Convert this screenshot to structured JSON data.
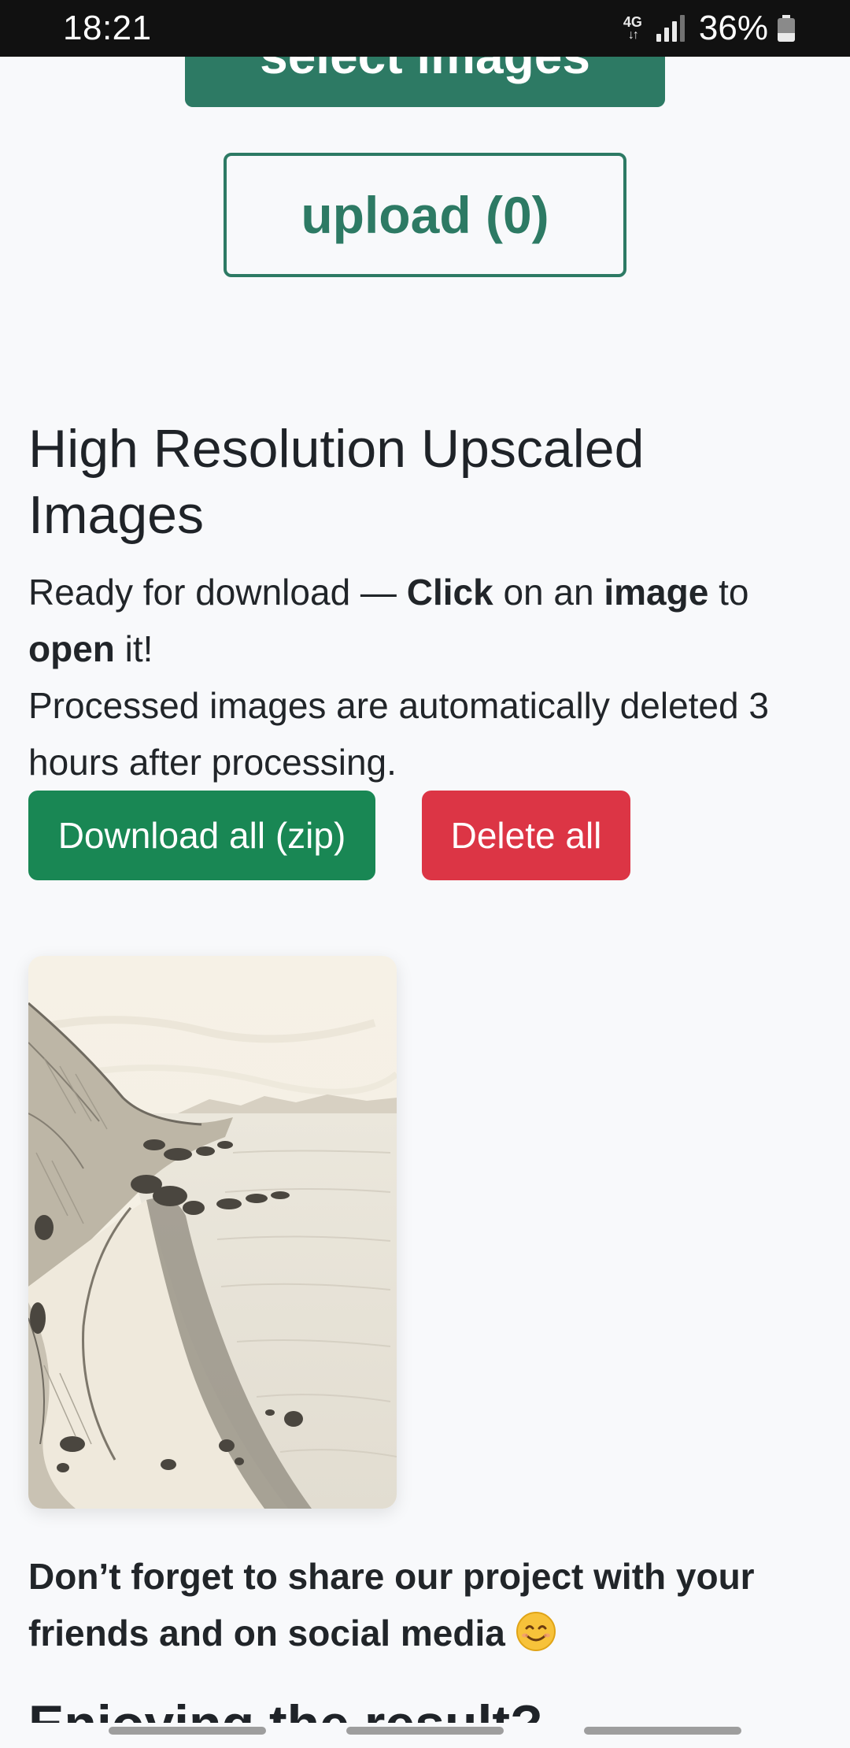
{
  "status_bar": {
    "time": "18:21",
    "network": "4G",
    "network_arrows": "↓↑",
    "battery_percent": "36%",
    "battery_level": 0.36,
    "icons": [
      "network-4g-icon",
      "signal-icon",
      "battery-icon"
    ]
  },
  "actions": {
    "select_label": "select images",
    "upload_label": "upload (0)"
  },
  "results": {
    "title": "High Resolution Upscaled Images",
    "ready_text_1": "Ready for download — ",
    "ready_bold_click": "Click",
    "ready_text_2": " on an ",
    "ready_bold_image": "image",
    "ready_text_3": " to ",
    "ready_bold_open": "open",
    "ready_text_4": " it!",
    "auto_delete_note": "Processed images are automatically deleted 3 hours after processing.",
    "download_all_label": "Download all (zip)",
    "delete_all_label": "Delete all"
  },
  "gallery": {
    "items": [
      {
        "kind": "pencil sketch of a coastal beach"
      }
    ]
  },
  "share": {
    "text": "Don’t forget to share our project with your friends and on social media",
    "emoji_icon": "smiling-face-icon"
  },
  "next_section": {
    "title": "Enjoying the result?"
  },
  "colors": {
    "primary": "#2d7a64",
    "success": "#198754",
    "danger": "#dc3545",
    "background": "#f8f9fb",
    "status_bar": "#111111"
  }
}
